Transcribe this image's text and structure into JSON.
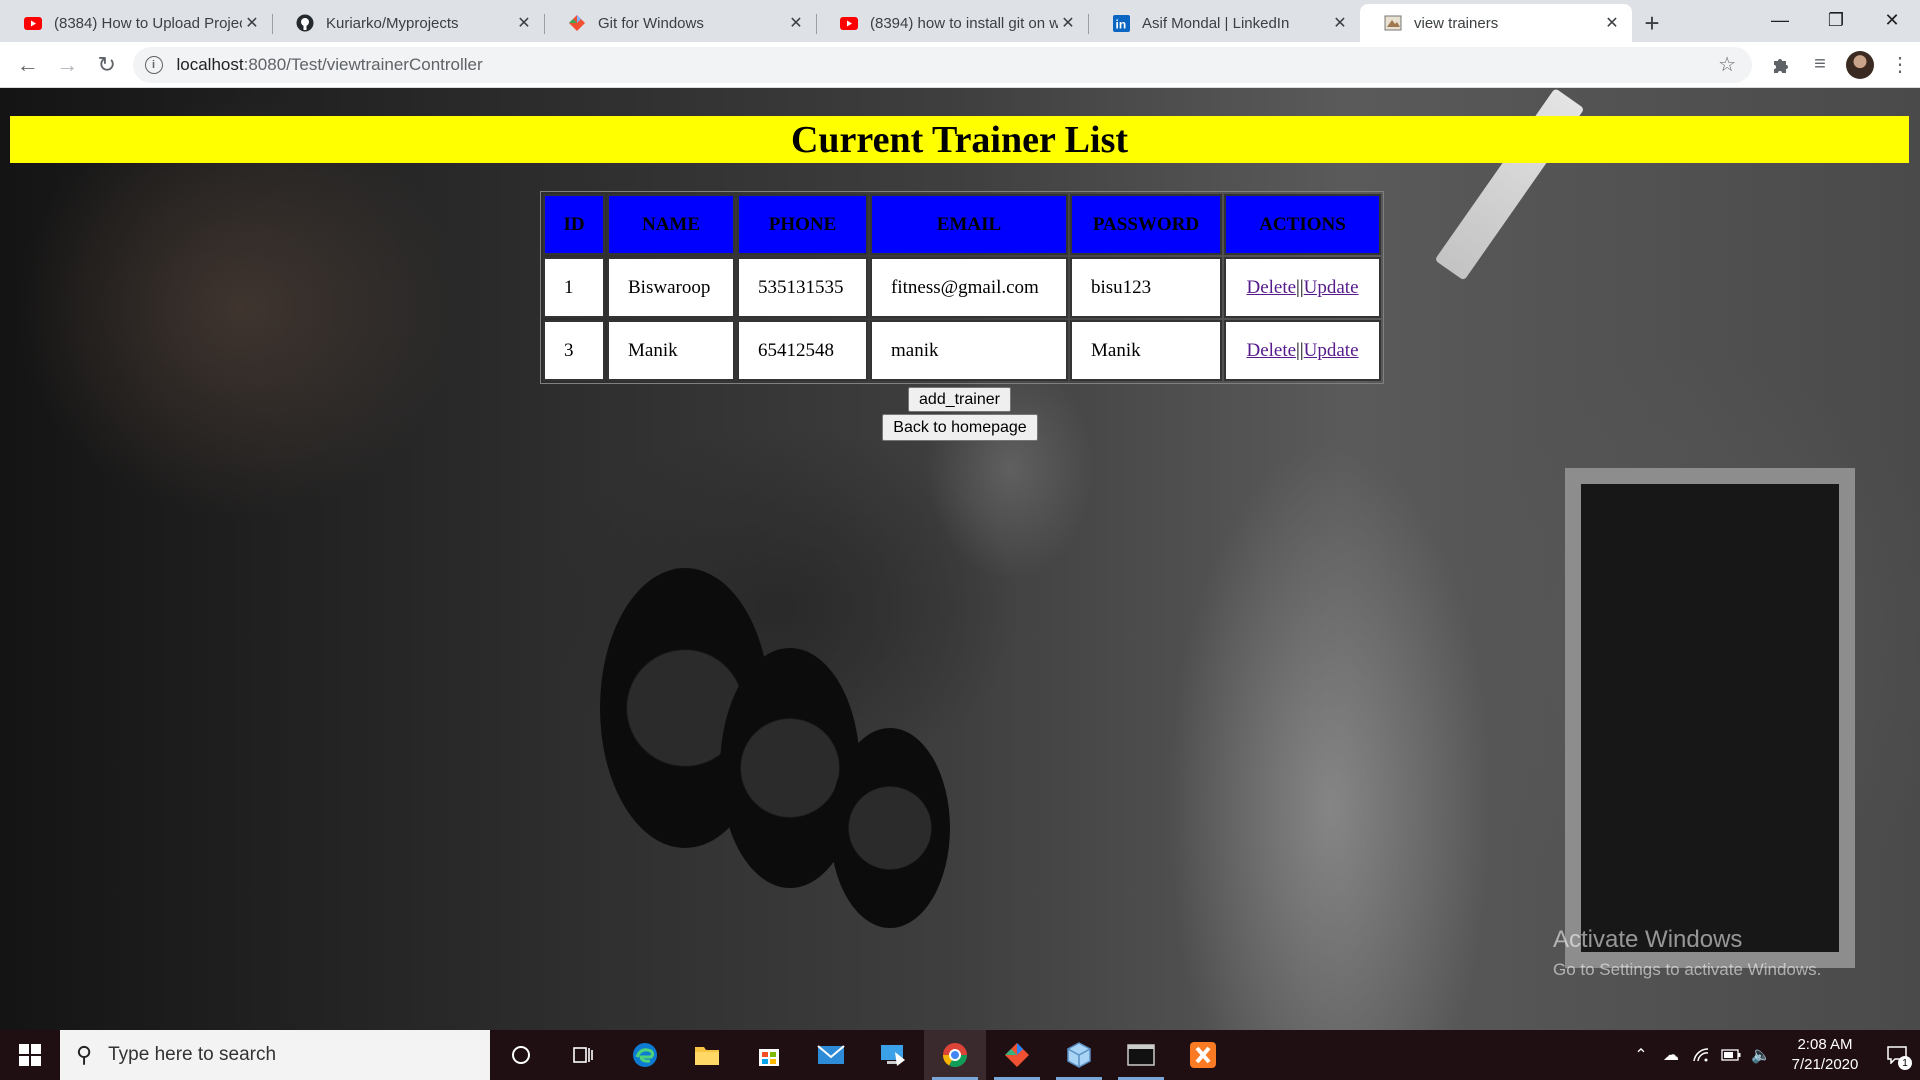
{
  "browser": {
    "tabs": [
      {
        "title": "(8384) How to Upload Projec",
        "icon": "youtube-icon"
      },
      {
        "title": "Kuriarko/Myprojects",
        "icon": "github-icon"
      },
      {
        "title": "Git for Windows",
        "icon": "git-icon"
      },
      {
        "title": "(8394) how to install git on w",
        "icon": "youtube-icon"
      },
      {
        "title": "Asif Mondal | LinkedIn",
        "icon": "linkedin-icon"
      },
      {
        "title": "view trainers",
        "icon": "page-icon"
      }
    ],
    "url_host": "localhost",
    "url_path": ":8080/Test/viewtrainerController"
  },
  "page": {
    "heading": "Current Trainer List",
    "table": {
      "headers": [
        "ID",
        "NAME",
        "PHONE",
        "EMAIL",
        "PASSWORD",
        "ACTIONS"
      ],
      "rows": [
        {
          "id": "1",
          "name": "Biswaroop",
          "phone": "535131535",
          "email": "fitness@gmail.com",
          "password": "bisu123"
        },
        {
          "id": "3",
          "name": "Manik",
          "phone": "65412548",
          "email": "manik",
          "password": "Manik"
        }
      ],
      "delete_label": "Delete",
      "separator": "||",
      "update_label": "Update"
    },
    "add_button": "add_trainer",
    "home_button": "Back to homepage"
  },
  "watermark": {
    "line1": "Activate Windows",
    "line2": "Go to Settings to activate Windows."
  },
  "taskbar": {
    "search_placeholder": "Type here to search",
    "time": "2:08 AM",
    "date": "7/21/2020",
    "notification_count": "1"
  },
  "colors": {
    "banner": "#ffff00",
    "table_header": "#0000ff",
    "link": "#1a0dab"
  }
}
